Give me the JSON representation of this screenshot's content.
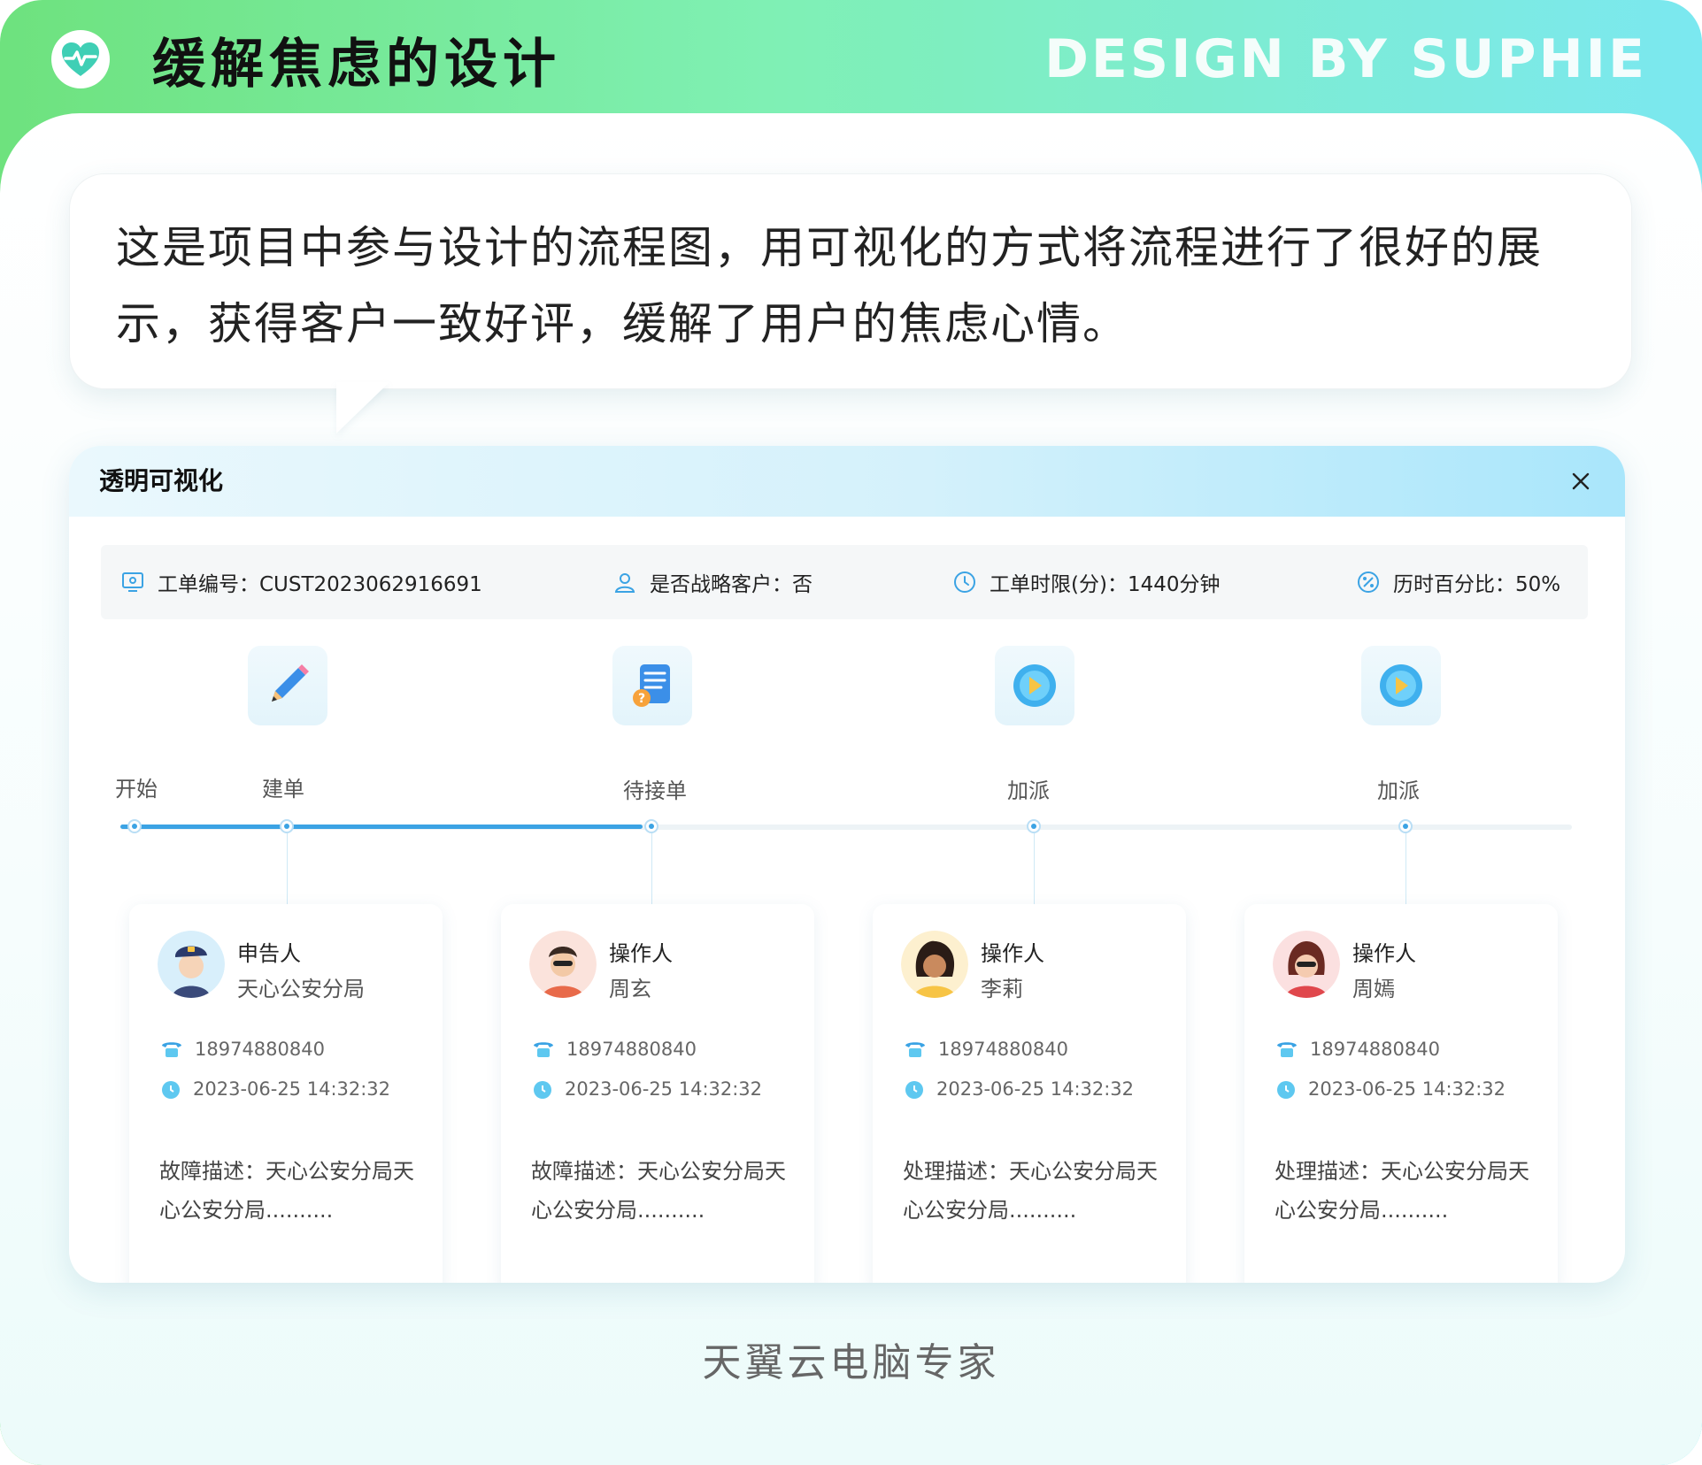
{
  "header": {
    "title": "缓解焦虑的设计",
    "design_by": "DESIGN BY SUPHIE",
    "icon": "heart-pulse-icon"
  },
  "bubble": {
    "text": "这是项目中参与设计的流程图，用可视化的方式将流程进行了很好的展示，获得客户一致好评，缓解了用户的焦虑心情。"
  },
  "panel": {
    "title": "透明可视化",
    "close_icon": "close-icon",
    "info": {
      "order_no": "工单编号：CUST2023062916691",
      "strategic": "是否战略客户：否",
      "time_limit": "工单时限(分)：1440分钟",
      "percent": "历时百分比：50%"
    },
    "start_label": "开始",
    "progress_fraction": 0.36,
    "steps": [
      {
        "label": "建单",
        "icon": "pencil-icon",
        "role": "申告人",
        "name": "天心公安分局",
        "phone": "18974880840",
        "time": "2023-06-25 14:32:32",
        "desc": "故障描述：天心公安分局天心公安分局..........",
        "avatar": "police-avatar"
      },
      {
        "label": "待接单",
        "icon": "document-icon",
        "role": "操作人",
        "name": "周玄",
        "phone": "18974880840",
        "time": "2023-06-25 14:32:32",
        "desc": "故障描述：天心公安分局天心公安分局..........",
        "avatar": "man-avatar"
      },
      {
        "label": "加派",
        "icon": "dispatch-icon",
        "role": "操作人",
        "name": "李莉",
        "phone": "18974880840",
        "time": "2023-06-25 14:32:32",
        "desc": "处理描述：天心公安分局天心公安分局..........",
        "avatar": "woman-avatar"
      },
      {
        "label": "加派",
        "icon": "dispatch-icon",
        "role": "操作人",
        "name": "周嫣",
        "phone": "18974880840",
        "time": "2023-06-25 14:32:32",
        "desc": "处理描述：天心公安分局天心公安分局..........",
        "avatar": "woman-sunglasses-avatar"
      }
    ]
  },
  "footer": {
    "text": "天翼云电脑专家"
  },
  "colors": {
    "accent": "#3ba3e4",
    "header_green": "#6ee27e",
    "header_cyan": "#7be8f0"
  }
}
